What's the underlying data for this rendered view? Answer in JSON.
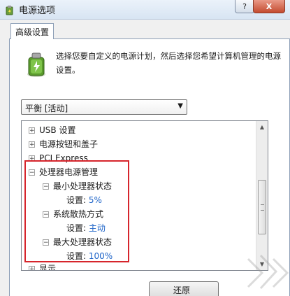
{
  "window": {
    "title": "电源选项",
    "help_label": "?",
    "close_label": "X"
  },
  "tab": {
    "label": "高级设置"
  },
  "description": "选择您要自定义的电源计划，然后选择您希望计算机管理的电源设置。",
  "plan_select": {
    "value": "平衡 [活动]"
  },
  "tree": {
    "items": [
      {
        "expander": "+",
        "label": "USB 设置"
      },
      {
        "expander": "+",
        "label": "电源按钮和盖子"
      },
      {
        "expander": "+",
        "label": "PCI Express"
      },
      {
        "expander": "−",
        "label": "处理器电源管理"
      },
      {
        "expander": "−",
        "label": "最小处理器状态"
      },
      {
        "setting_label": "设置:",
        "setting_value": "5%"
      },
      {
        "expander": "−",
        "label": "系统散热方式"
      },
      {
        "setting_label": "设置:",
        "setting_value": "主动"
      },
      {
        "expander": "−",
        "label": "最大处理器状态"
      },
      {
        "setting_label": "设置:",
        "setting_value": "100%"
      },
      {
        "expander": "+",
        "label": "显示"
      }
    ]
  },
  "buttons": {
    "restore_label": "还原"
  },
  "colors": {
    "highlight": "#d6252c",
    "setting_value": "#1e64c8"
  }
}
